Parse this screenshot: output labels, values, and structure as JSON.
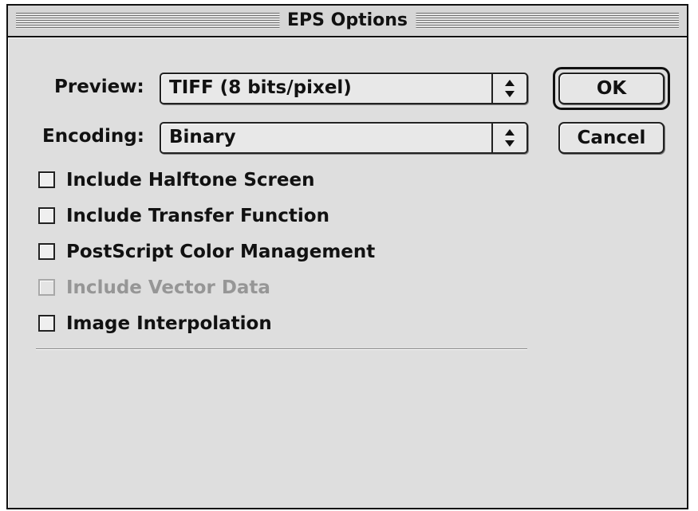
{
  "dialog": {
    "title": "EPS Options"
  },
  "preview": {
    "label": "Preview:",
    "value": "TIFF  (8 bits/pixel)"
  },
  "encoding": {
    "label": "Encoding:",
    "value": "Binary"
  },
  "buttons": {
    "ok": "OK",
    "cancel": "Cancel"
  },
  "options": [
    {
      "label": "Include Halftone Screen",
      "checked": false,
      "enabled": true
    },
    {
      "label": "Include Transfer Function",
      "checked": false,
      "enabled": true
    },
    {
      "label": "PostScript Color Management",
      "checked": false,
      "enabled": true
    },
    {
      "label": "Include Vector Data",
      "checked": false,
      "enabled": false
    },
    {
      "label": "Image Interpolation",
      "checked": false,
      "enabled": true
    }
  ],
  "icons": {
    "popup_arrows": "up-down-arrows-icon"
  },
  "colors": {
    "dialog_background": "#dedede",
    "disabled_text": "#969696"
  }
}
